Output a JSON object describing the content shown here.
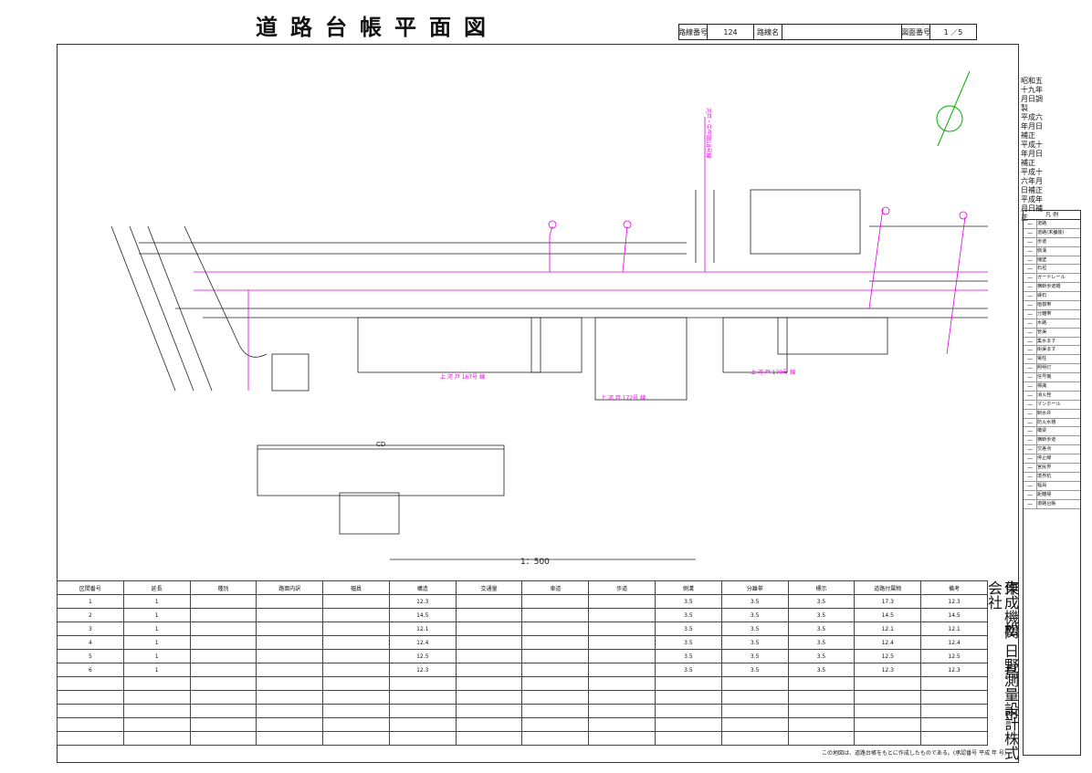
{
  "title": "道路台帳平面図",
  "header": {
    "route_no_label": "路線番号",
    "route_no": "124",
    "route_name_label": "路線名",
    "route_name": "",
    "sheet_label": "図面番号",
    "sheet_value": "1 ／5"
  },
  "stamps": [
    "昭和五十九年月日調製",
    "平成六年月日補正",
    "平成十年月日補正",
    "平成十六年月日補正",
    "平成年月日補正"
  ],
  "plan_labels": {
    "road_a": "上 河 戸 167号 線",
    "road_b": "上 河 戸 170号 線",
    "road_c": "上 河 戸 172号 線",
    "road_d": "河戸・中牛田18号線",
    "scale": "1：500",
    "section_cd": "CD"
  },
  "legend": {
    "title": "凡 例",
    "items": [
      "道路",
      "道路(未舗装)",
      "歩道",
      "側溝",
      "擁壁",
      "石垣",
      "ガードレール",
      "横断歩道橋",
      "縁石",
      "植樹帯",
      "分離帯",
      "水路",
      "管渠",
      "集水ます",
      "街渠ます",
      "電柱",
      "照明灯",
      "信号機",
      "標識",
      "消火栓",
      "マンホール",
      "制水弁",
      "防火水槽",
      "橋梁",
      "横断歩道",
      "交差点",
      "停止線",
      "官民界",
      "境界杭",
      "幅員",
      "距離標",
      "道路台帳"
    ]
  },
  "company": "作成機関 日野測量設計株式会社",
  "city": "東松島市",
  "table": {
    "headers": [
      "区間番号",
      "延長",
      "種別",
      "路面内訳",
      "幅員",
      "構造",
      "交通量",
      "車道",
      "歩道",
      "側溝",
      "分離帯",
      "標示",
      "道路付属物",
      "備考"
    ],
    "rows": [
      [
        "1",
        "1",
        "",
        "",
        "",
        "12.3",
        "",
        "",
        "",
        "3.5",
        "3.5",
        "3.5",
        "17.3",
        "12.3"
      ],
      [
        "2",
        "1",
        "",
        "",
        "",
        "14.5",
        "",
        "",
        "",
        "3.5",
        "3.5",
        "3.5",
        "14.5",
        "14.5"
      ],
      [
        "3",
        "1",
        "",
        "",
        "",
        "12.1",
        "",
        "",
        "",
        "3.5",
        "3.5",
        "3.5",
        "12.1",
        "12.1"
      ],
      [
        "4",
        "1",
        "",
        "",
        "",
        "12.4",
        "",
        "",
        "",
        "3.5",
        "3.5",
        "3.5",
        "12.4",
        "12.4"
      ],
      [
        "5",
        "1",
        "",
        "",
        "",
        "12.5",
        "",
        "",
        "",
        "3.5",
        "3.5",
        "3.5",
        "12.5",
        "12.5"
      ],
      [
        "6",
        "1",
        "",
        "",
        "",
        "12.3",
        "",
        "",
        "",
        "3.5",
        "3.5",
        "3.5",
        "12.3",
        "12.3"
      ]
    ]
  },
  "footer_note": "この地図は、道路台帳をもとに作成したものである。(承認番号 平成 年 号)",
  "colors": {
    "magenta": "#e000e0",
    "green": "#00b000",
    "ink": "#222222"
  }
}
